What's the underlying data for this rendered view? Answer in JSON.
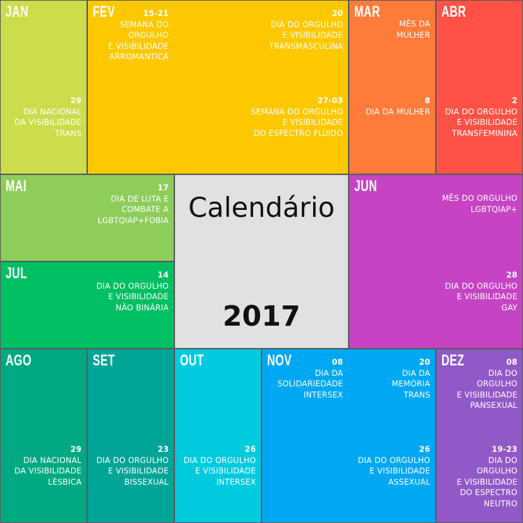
{
  "title": "Calendário",
  "year": "2017",
  "colors": {
    "jan": "#cddc4a",
    "fev": "#fec800",
    "mar": "#ff7b3a",
    "abr": "#ff5145",
    "mai": "#8dcd5a",
    "jun": "#c644c4",
    "jul": "#00c063",
    "ago": "#00a981",
    "set": "#00a598",
    "out": "#00cbde",
    "nov": "#00a8f3",
    "dez": "#9159c7",
    "center": "#e1e1e1"
  },
  "months": {
    "jan": {
      "name": "JAN",
      "events": [
        {
          "date": "29",
          "text": [
            "DIA NACIONAL",
            "DA VISIBILIDADE",
            "TRANS"
          ]
        }
      ]
    },
    "fev": {
      "name": "FEV",
      "events": [
        {
          "date": "15-21",
          "text": [
            "SEMANA DO",
            "ORGULHO",
            "E VISIBILIDADE",
            "ARROMANTICA"
          ]
        },
        {
          "date": "20",
          "text": [
            "DIA DO ORGULHO",
            "E VISIBILIDADE",
            "TRANSMASCULINA"
          ]
        },
        {
          "date": "27-03",
          "text": [
            "SEMANA DO ORGULHO",
            "E VISIBILIDADE",
            "DO ESPECTRO FLUIDO"
          ]
        }
      ]
    },
    "mar": {
      "name": "MAR",
      "events": [
        {
          "date": "",
          "text": [
            "MÊS DA",
            "MULHER"
          ]
        },
        {
          "date": "8",
          "text": [
            "DIA DA MULHER"
          ]
        }
      ]
    },
    "abr": {
      "name": "ABR",
      "events": [
        {
          "date": "2",
          "text": [
            "DIA DO ORGULHO",
            "E VISIBILIDADE",
            "TRANSFEMININA"
          ]
        }
      ]
    },
    "mai": {
      "name": "MAI",
      "events": [
        {
          "date": "17",
          "text": [
            "DIA DE LUTA E",
            "COMBATE A",
            "LGBTQIAP+FOBIA"
          ]
        }
      ]
    },
    "jun": {
      "name": "JUN",
      "events": [
        {
          "date": "",
          "text": [
            "MÊS DO ORGULHO",
            "LGBTQIAP+"
          ]
        },
        {
          "date": "28",
          "text": [
            "DIA DO ORGULHO",
            "E VISIBILIDADE",
            "GAY"
          ]
        }
      ]
    },
    "jul": {
      "name": "JUL",
      "events": [
        {
          "date": "14",
          "text": [
            "DIA DO ORGULHO",
            "E VISIBILIDADE",
            "NÃO BINÁRIA"
          ]
        }
      ]
    },
    "ago": {
      "name": "AGO",
      "events": [
        {
          "date": "29",
          "text": [
            "DIA NACIONAL",
            "DA VISIBILIDADE",
            "LÉSBICA"
          ]
        }
      ]
    },
    "set": {
      "name": "SET",
      "events": [
        {
          "date": "23",
          "text": [
            "DIA DO ORGULHO",
            "E VISIBILIDADE",
            "BISSEXUAL"
          ]
        }
      ]
    },
    "out": {
      "name": "OUT",
      "events": [
        {
          "date": "26",
          "text": [
            "DIA DO ORGULHO",
            "E VISIBILIDADE",
            "INTERSEX"
          ]
        }
      ]
    },
    "nov": {
      "name": "NOV",
      "events": [
        {
          "date": "08",
          "text": [
            "DIA DA",
            "SOLIDARIEDADE",
            "INTERSEX"
          ]
        },
        {
          "date": "20",
          "text": [
            "DIA DA",
            "MEMÓRIA",
            "TRANS"
          ]
        },
        {
          "date": "26",
          "text": [
            "DIA DO ORGULHO",
            "E VISIBILIDADE",
            "ASSEXUAL"
          ]
        }
      ]
    },
    "dez": {
      "name": "DEZ",
      "events": [
        {
          "date": "08",
          "text": [
            "DIA DO",
            "ORGULHO",
            "E VISIBILIDADE",
            "PANSEXUAL"
          ]
        },
        {
          "date": "19-23",
          "text": [
            "DIA DO",
            "ORGULHO",
            "E VISIBILIDADE",
            "DO ESPECTRO",
            "NEUTRO"
          ]
        }
      ]
    }
  }
}
